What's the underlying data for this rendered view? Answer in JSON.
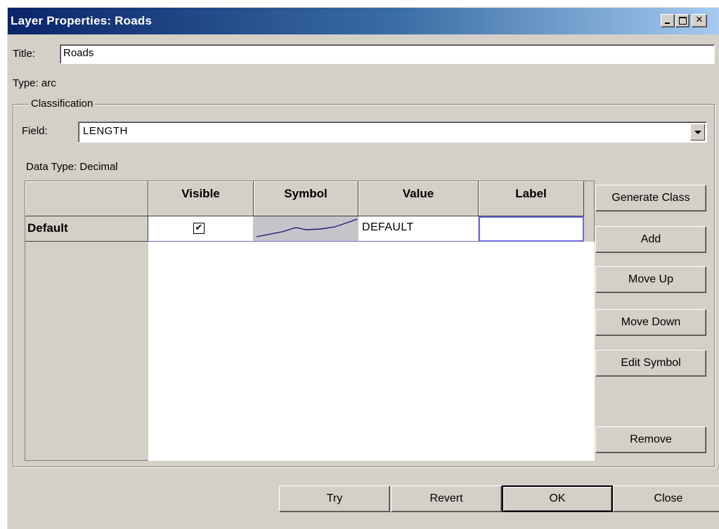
{
  "window": {
    "title": "Layer Properties: Roads"
  },
  "form": {
    "title_label": "Title:",
    "title_value": "Roads",
    "type_text": "Type: arc"
  },
  "classification": {
    "legend": "Classification",
    "field_label": "Field:",
    "field_value": "LENGTH",
    "data_type_text": "Data Type: Decimal"
  },
  "grid": {
    "columns": [
      "Visible",
      "Symbol",
      "Value",
      "Label"
    ],
    "rows": [
      {
        "name": "Default",
        "visible": true,
        "visible_mark": "✔",
        "symbol": "line-symbol",
        "value": "DEFAULT",
        "label": ""
      }
    ]
  },
  "side_buttons": {
    "generate_class": "Generate Class",
    "add": "Add",
    "move_up": "Move Up",
    "move_down": "Move Down",
    "edit_symbol": "Edit Symbol",
    "remove": "Remove"
  },
  "footer_buttons": {
    "try": "Try",
    "revert": "Revert",
    "ok": "OK",
    "close": "Close"
  },
  "colors": {
    "titlebar_start": "#0a246a",
    "titlebar_end": "#a6caf0",
    "face": "#d4d0c8",
    "selection_border": "#6b6bd6"
  },
  "icons": {
    "minimize": "minimize-icon",
    "maximize": "maximize-icon",
    "close": "close-icon",
    "dropdown": "chevron-down-icon",
    "checkbox": "checkbox-icon"
  }
}
